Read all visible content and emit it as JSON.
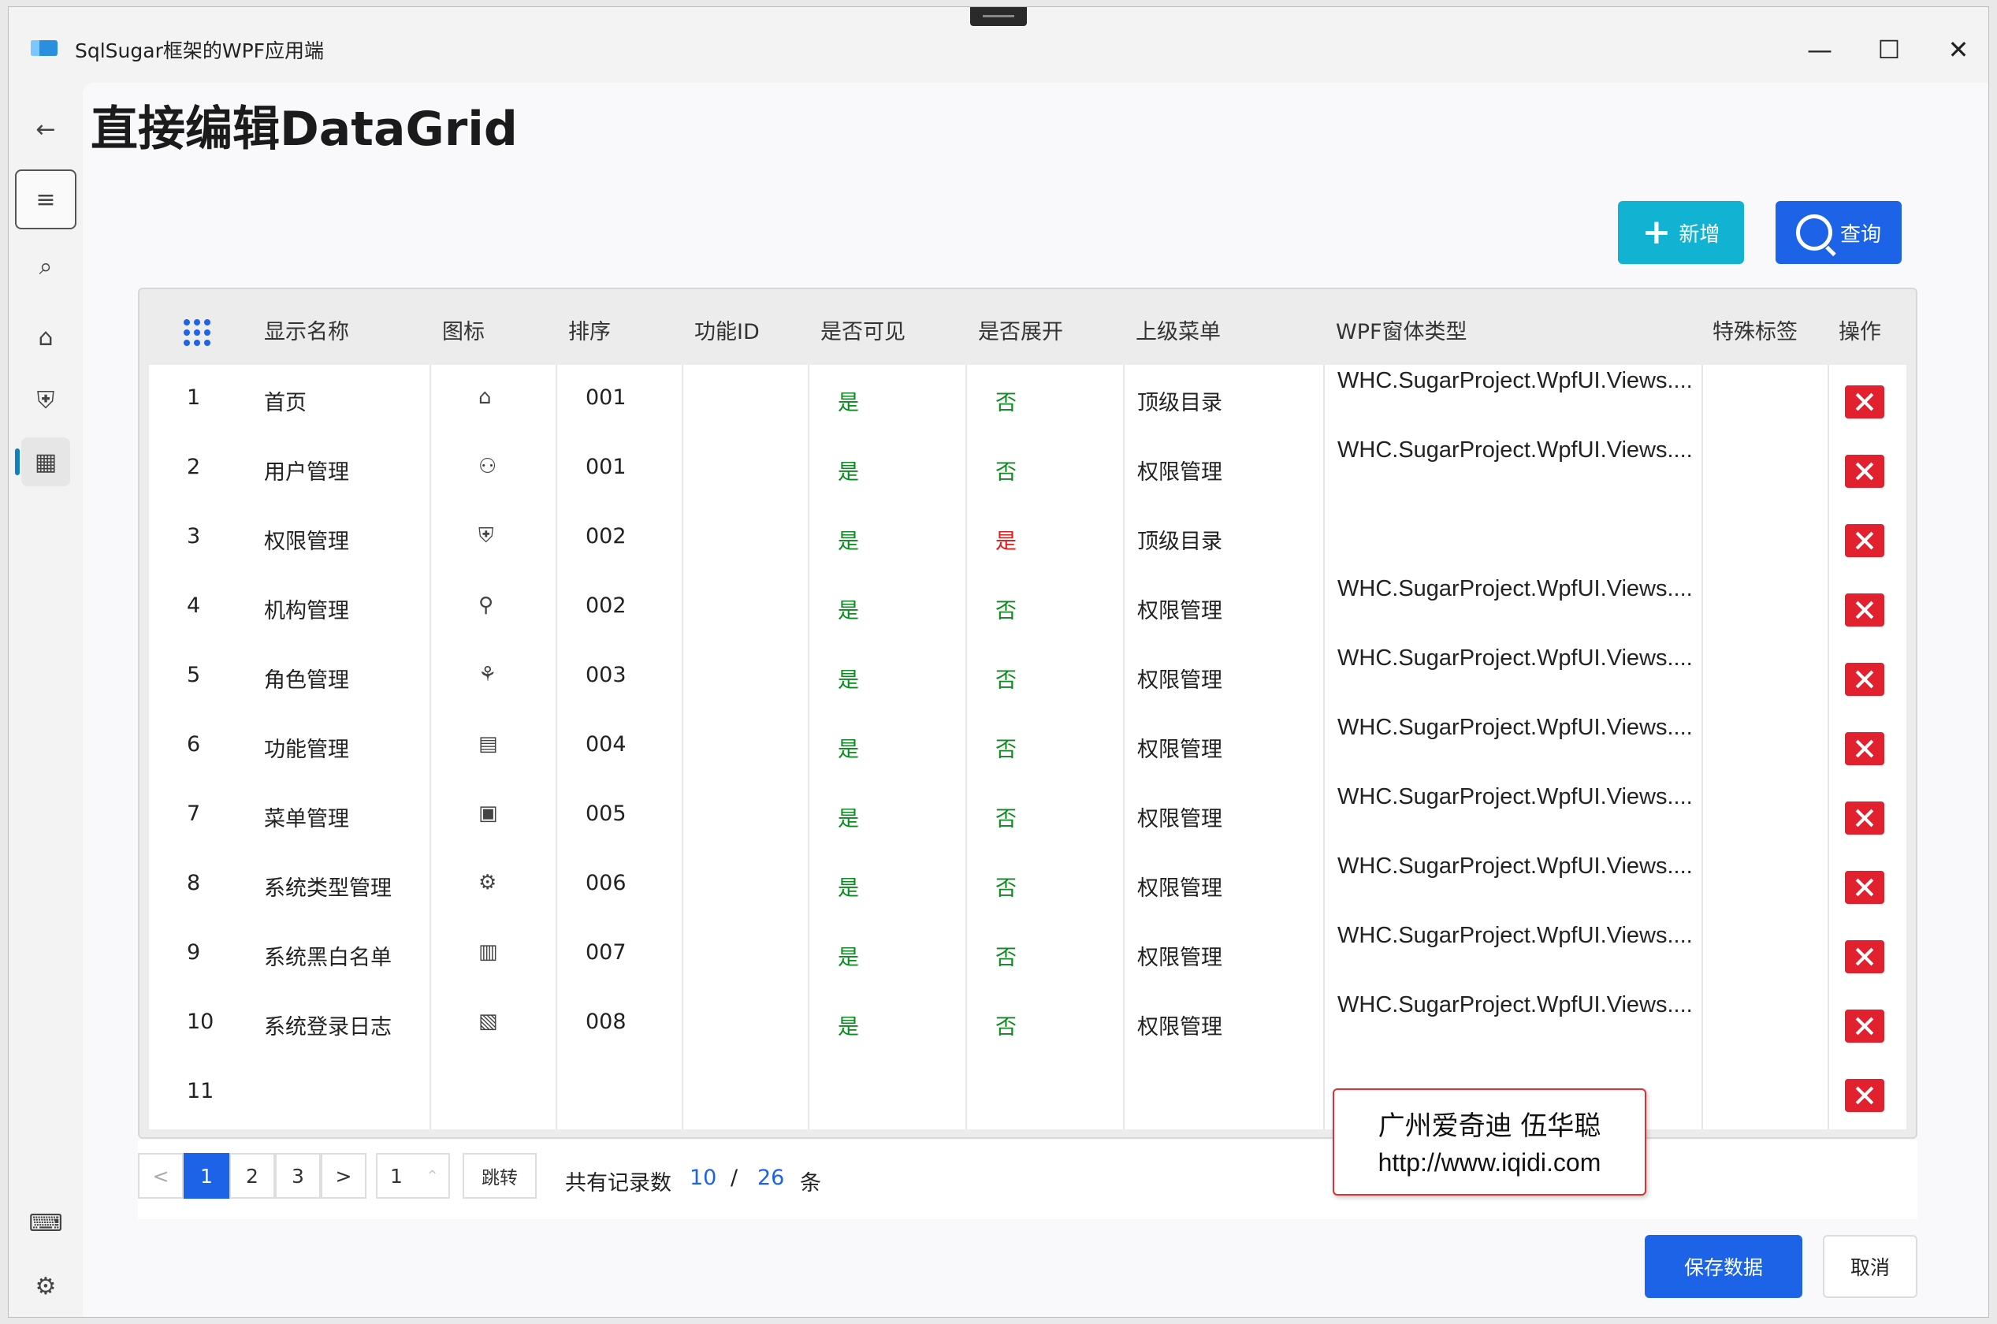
{
  "window": {
    "title": "SqlSugar框架的WPF应用端",
    "minimize": "—",
    "maximize": "☐",
    "close": "✕"
  },
  "nav": {
    "back": "←",
    "menu": "≡",
    "search": "⌕",
    "home": "⌂",
    "security": "⛨",
    "grid": "▦",
    "keyboard": "⌨",
    "settings": "⚙"
  },
  "page": {
    "title": "直接编辑DataGrid"
  },
  "toolbar": {
    "add_label": "新增",
    "add_icon": "+",
    "query_label": "查询"
  },
  "grid": {
    "headers": [
      "显示名称",
      "图标",
      "排序",
      "功能ID",
      "是否可见",
      "是否展开",
      "上级菜单",
      "WPF窗体类型",
      "特殊标签",
      "操作"
    ],
    "rows": [
      {
        "no": "1",
        "name": "首页",
        "icon": "⌂",
        "icon_name": "home-icon",
        "sort": "001",
        "func_id": "",
        "visible": "是",
        "expand": "否",
        "parent": "顶级目录",
        "wpf": "WHC.SugarProject.WpfUI.Views....",
        "tag": ""
      },
      {
        "no": "2",
        "name": "用户管理",
        "icon": "⚇",
        "icon_name": "user-lock-icon",
        "sort": "001",
        "func_id": "",
        "visible": "是",
        "expand": "否",
        "parent": "权限管理",
        "wpf": "WHC.SugarProject.WpfUI.Views....",
        "tag": ""
      },
      {
        "no": "3",
        "name": "权限管理",
        "icon": "⛨",
        "icon_name": "shield-icon",
        "sort": "002",
        "func_id": "",
        "visible": "是",
        "expand": "是",
        "parent": "顶级目录",
        "wpf": "",
        "tag": ""
      },
      {
        "no": "4",
        "name": "机构管理",
        "icon": "⚲",
        "icon_name": "org-tree-icon",
        "sort": "002",
        "func_id": "",
        "visible": "是",
        "expand": "否",
        "parent": "权限管理",
        "wpf": "WHC.SugarProject.WpfUI.Views....",
        "tag": ""
      },
      {
        "no": "5",
        "name": "角色管理",
        "icon": "⚘",
        "icon_name": "person-icon",
        "sort": "003",
        "func_id": "",
        "visible": "是",
        "expand": "否",
        "parent": "权限管理",
        "wpf": "WHC.SugarProject.WpfUI.Views....",
        "tag": ""
      },
      {
        "no": "6",
        "name": "功能管理",
        "icon": "▤",
        "icon_name": "clipboard-icon",
        "sort": "004",
        "func_id": "",
        "visible": "是",
        "expand": "否",
        "parent": "权限管理",
        "wpf": "WHC.SugarProject.WpfUI.Views....",
        "tag": ""
      },
      {
        "no": "7",
        "name": "菜单管理",
        "icon": "▣",
        "icon_name": "menu-box-icon",
        "sort": "005",
        "func_id": "",
        "visible": "是",
        "expand": "否",
        "parent": "权限管理",
        "wpf": "WHC.SugarProject.WpfUI.Views....",
        "tag": ""
      },
      {
        "no": "8",
        "name": "系统类型管理",
        "icon": "⚙",
        "icon_name": "type-settings-icon",
        "sort": "006",
        "func_id": "",
        "visible": "是",
        "expand": "否",
        "parent": "权限管理",
        "wpf": "WHC.SugarProject.WpfUI.Views....",
        "tag": ""
      },
      {
        "no": "9",
        "name": "系统黑白名单",
        "icon": "▥",
        "icon_name": "list-icon",
        "sort": "007",
        "func_id": "",
        "visible": "是",
        "expand": "否",
        "parent": "权限管理",
        "wpf": "WHC.SugarProject.WpfUI.Views....",
        "tag": ""
      },
      {
        "no": "10",
        "name": "系统登录日志",
        "icon": "▧",
        "icon_name": "document-icon",
        "sort": "008",
        "func_id": "",
        "visible": "是",
        "expand": "否",
        "parent": "权限管理",
        "wpf": "WHC.SugarProject.WpfUI.Views....",
        "tag": ""
      },
      {
        "no": "11",
        "name": "",
        "icon": "",
        "icon_name": "",
        "sort": "",
        "func_id": "",
        "visible": "",
        "expand": "",
        "parent": "",
        "wpf": "",
        "tag": ""
      }
    ]
  },
  "pager": {
    "prev": "<",
    "next": ">",
    "pages": [
      "1",
      "2",
      "3"
    ],
    "current": "1",
    "jump_value": "1",
    "jump_label": "跳转",
    "total_label": "共有记录数",
    "page_size": "10",
    "separator": "/",
    "total": "26",
    "unit": "条"
  },
  "watermark": {
    "line1": "广州爱奇迪 伍华聪",
    "line2": "http://www.iqidi.com"
  },
  "footer": {
    "save_label": "保存数据",
    "cancel_label": "取消"
  },
  "colors": {
    "primary": "#1c63e8",
    "add": "#12b3d2",
    "delete": "#e2212e",
    "yes": "#0d8a20",
    "yes_expand": "#e01b1b"
  }
}
